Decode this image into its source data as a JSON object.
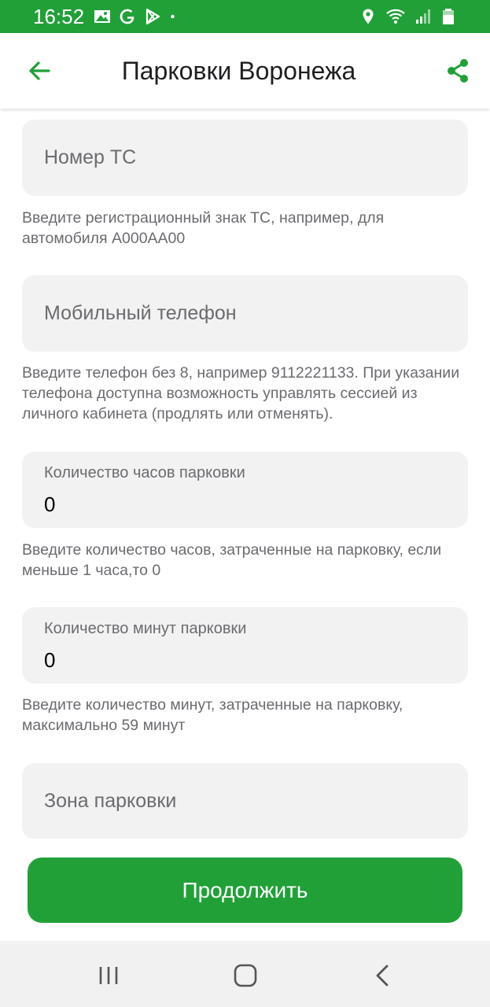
{
  "status_bar": {
    "time": "16:52",
    "left_icons": [
      "image-icon",
      "google-icon",
      "play-store-icon",
      "dot-icon"
    ],
    "right_icons": [
      "location-icon",
      "wifi-icon",
      "signal-icon",
      "battery-icon"
    ],
    "color": "#21a038"
  },
  "app_bar": {
    "title": "Парковки Воронежа",
    "back_icon": "arrow-back-icon",
    "share_icon": "share-icon"
  },
  "form": {
    "vehicle_number": {
      "placeholder": "Номер ТС",
      "hint": "Введите регистрационный знак ТС, например, для автомобиля А000АА00"
    },
    "phone": {
      "placeholder": "Мобильный телефон",
      "hint": "Введите телефон без 8, например 9112221133. При указании телефона доступна возможность управлять сессией из личного кабинета (продлять или отменять)."
    },
    "hours": {
      "label": "Количество часов парковки",
      "value": "0",
      "hint": "Введите количество часов, затраченные на парковку, если меньше 1 часа,то 0"
    },
    "minutes": {
      "label": "Количество минут парковки",
      "value": "0",
      "hint": "Введите количество минут, затраченные на парковку, максимально  59 минут"
    },
    "zone": {
      "placeholder": "Зона парковки"
    }
  },
  "footer": {
    "continue_label": "Продолжить"
  },
  "nav_bar": {
    "icons": [
      "recent-apps-icon",
      "home-icon",
      "back-nav-icon"
    ]
  },
  "colors": {
    "accent": "#21a038",
    "field_bg": "#f2f2f2",
    "hint_text": "#6b6b70"
  }
}
